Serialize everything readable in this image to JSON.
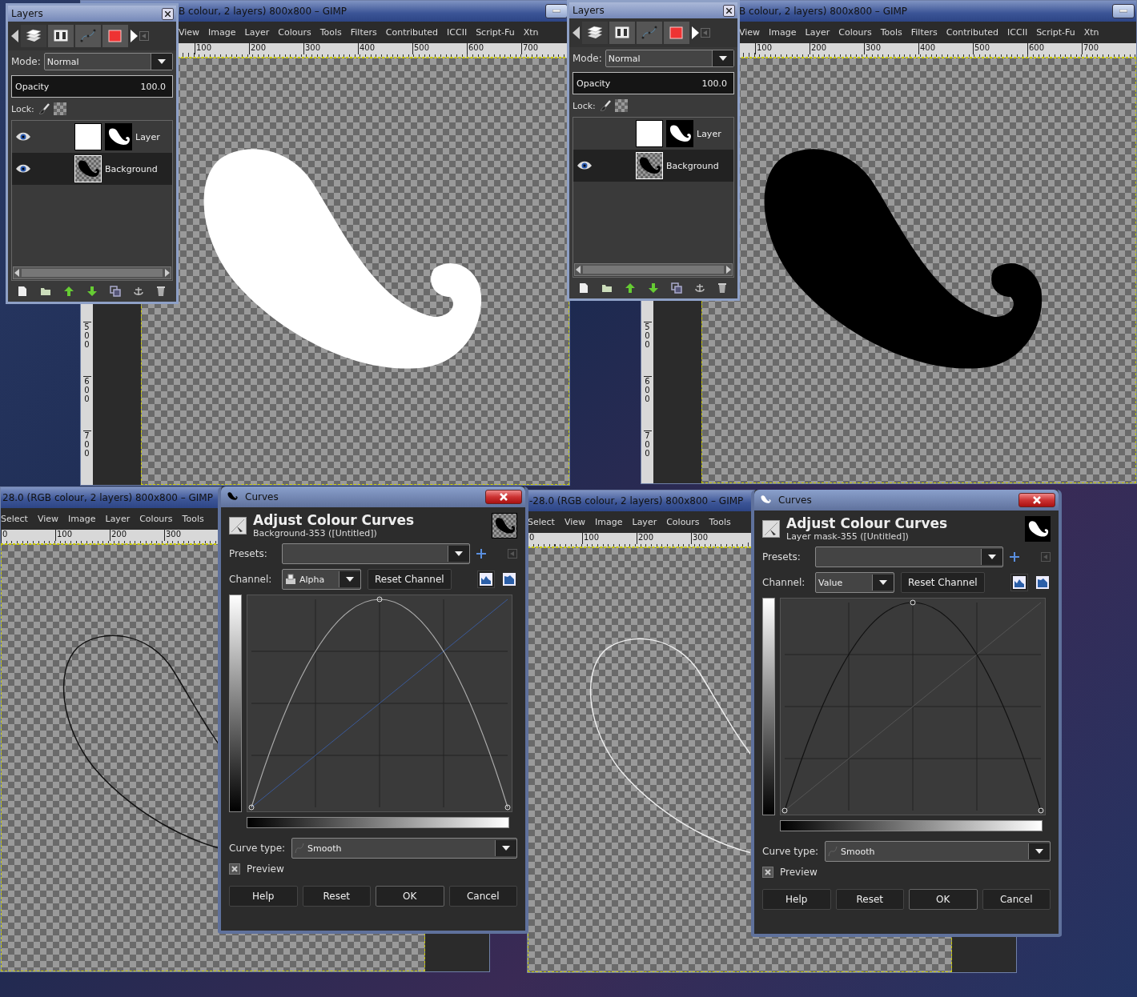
{
  "image_windows": [
    {
      "kind": "docked",
      "title": "B colour, 2 layers) 800x800 – GIMP",
      "menu": [
        "View",
        "Image",
        "Layer",
        "Colours",
        "Tools",
        "Filters",
        "Contributed",
        "ICCII",
        "Script-Fu",
        "Xtn"
      ],
      "ruler": [
        "100",
        "200",
        "300",
        "400",
        "500",
        "600",
        "700"
      ],
      "vruler": [
        "500",
        "600",
        "700"
      ],
      "shape": {
        "kind": "white-fill"
      }
    },
    {
      "kind": "docked",
      "title": "B colour, 2 layers) 800x800 – GIMP",
      "menu": [
        "View",
        "Image",
        "Layer",
        "Colours",
        "Tools",
        "Filters",
        "Contributed",
        "ICCII",
        "Script-Fu",
        "Xtn"
      ],
      "ruler": [
        "100",
        "200",
        "300",
        "400",
        "500",
        "600",
        "700"
      ],
      "vruler": [
        "500",
        "600",
        "700"
      ],
      "shape": {
        "kind": "black-fill"
      }
    },
    {
      "kind": "plain",
      "title": "28.0 (RGB colour, 2 layers) 800x800 – GIMP",
      "menu": [
        "Select",
        "View",
        "Image",
        "Layer",
        "Colours",
        "Tools"
      ],
      "ruler": [
        "0",
        "100",
        "200",
        "300"
      ],
      "shape": {
        "kind": "black-outline"
      }
    },
    {
      "kind": "plain",
      "title": "-28.0 (RGB colour, 2 layers) 800x800 – GIMP",
      "menu": [
        "Select",
        "View",
        "Image",
        "Layer",
        "Colours",
        "Tools"
      ],
      "ruler": [
        "0",
        "100",
        "200",
        "300"
      ],
      "shape": {
        "kind": "white-outline"
      }
    }
  ],
  "layers_docks": [
    {
      "title": "Layers",
      "tabs": [
        {
          "kind": "layers",
          "selected": true
        },
        {
          "kind": "channels",
          "selected": false
        },
        {
          "kind": "paths",
          "selected": false
        },
        {
          "kind": "colour",
          "selected": false
        }
      ],
      "mode_label": "Mode:",
      "mode": "Normal",
      "opacity": {
        "label": "Opacity",
        "value": "100.0",
        "level": 1
      },
      "lock_label": "Lock:",
      "layers": [
        {
          "name": "Layer",
          "kind": "masked",
          "visible": true,
          "selected": false
        },
        {
          "name": "Background",
          "kind": "plain",
          "visible": true,
          "selected": true
        }
      ]
    },
    {
      "title": "Layers",
      "tabs": [
        {
          "kind": "layers",
          "selected": true
        },
        {
          "kind": "channels",
          "selected": false
        },
        {
          "kind": "paths",
          "selected": false
        },
        {
          "kind": "colour",
          "selected": false
        }
      ],
      "mode_label": "Mode:",
      "mode": "Normal",
      "opacity": {
        "label": "Opacity",
        "value": "100.0",
        "level": 1
      },
      "lock_label": "Lock:",
      "layers": [
        {
          "name": "Layer",
          "kind": "masked",
          "visible": false,
          "selected": false
        },
        {
          "name": "Background",
          "kind": "plain",
          "visible": true,
          "selected": true
        }
      ]
    }
  ],
  "curves_dialogs": [
    {
      "title": "Curves",
      "heading": "Adjust Colour Curves",
      "subtitle": "Background-353 ([Untitled])",
      "thumb": {
        "kind": "layer"
      },
      "presets_label": "Presets:",
      "channel_label": "Channel:",
      "channel": "Alpha",
      "channel_icon": true,
      "reset_channel": "Reset Channel",
      "graph": {
        "kind": "light"
      },
      "curve_type_label": "Curve type:",
      "curve_type": "Smooth",
      "preview_label": "Preview",
      "preview_checked": true,
      "buttons": [
        "Help",
        "Reset",
        "OK",
        "Cancel"
      ]
    },
    {
      "title": "Curves",
      "heading": "Adjust Colour Curves",
      "subtitle": "Layer mask-355 ([Untitled])",
      "thumb": {
        "kind": "mask"
      },
      "presets_label": "Presets:",
      "channel_label": "Channel:",
      "channel": "Value",
      "channel_icon": false,
      "reset_channel": "Reset Channel",
      "graph": {
        "kind": "dark"
      },
      "curve_type_label": "Curve type:",
      "curve_type": "Smooth",
      "preview_label": "Preview",
      "preview_checked": true,
      "buttons": [
        "Help",
        "Reset",
        "OK",
        "Cancel"
      ]
    }
  ]
}
